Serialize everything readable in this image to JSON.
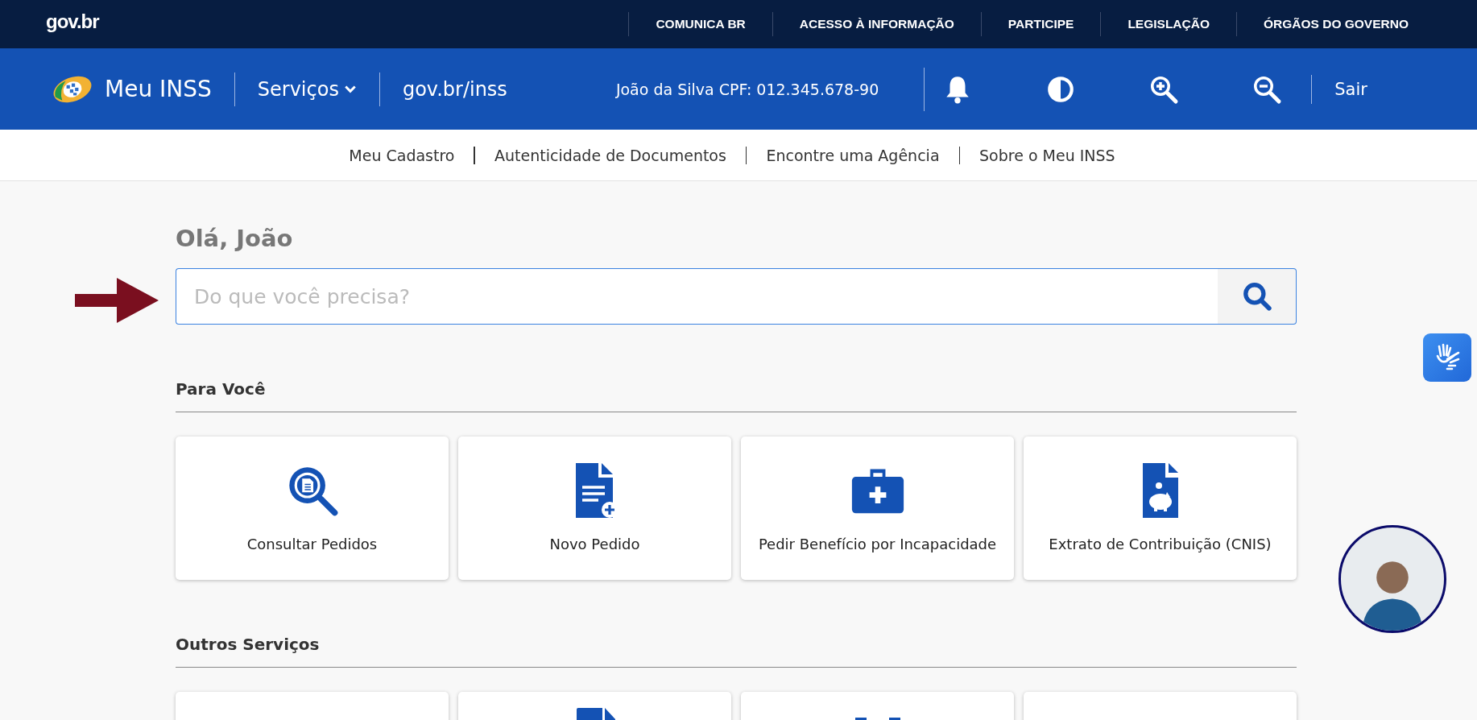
{
  "govbar": {
    "logo": "gov.br",
    "links": [
      "COMUNICA BR",
      "ACESSO À INFORMAÇÃO",
      "PARTICIPE",
      "LEGISLAÇÃO",
      "ÓRGÃOS DO GOVERNO"
    ]
  },
  "header": {
    "brand": "Meu INSS",
    "services_menu": "Serviços",
    "site": "gov.br/inss",
    "user": "João da Silva CPF: 012.345.678-90",
    "logout": "Sair"
  },
  "subnav": {
    "items": [
      "Meu Cadastro",
      "Autenticidade de Documentos",
      "Encontre uma Agência",
      "Sobre o Meu INSS"
    ]
  },
  "greeting": "Olá, João",
  "search": {
    "placeholder": "Do que você precisa?"
  },
  "sections": [
    {
      "title": "Para Você",
      "cards": [
        {
          "kind": "search-doc",
          "label": "Consultar Pedidos"
        },
        {
          "kind": "doc-plus",
          "label": "Novo Pedido"
        },
        {
          "kind": "medkit",
          "label": "Pedir Benefício por Incapacidade"
        },
        {
          "kind": "doc-piggy",
          "label": "Extrato de Contribuição (CNIS)"
        }
      ]
    },
    {
      "title": "Outros Serviços",
      "cards": [
        {
          "kind": "none"
        },
        {
          "kind": "doc-top"
        },
        {
          "kind": "grid-top"
        },
        {
          "kind": "none"
        }
      ]
    }
  ]
}
